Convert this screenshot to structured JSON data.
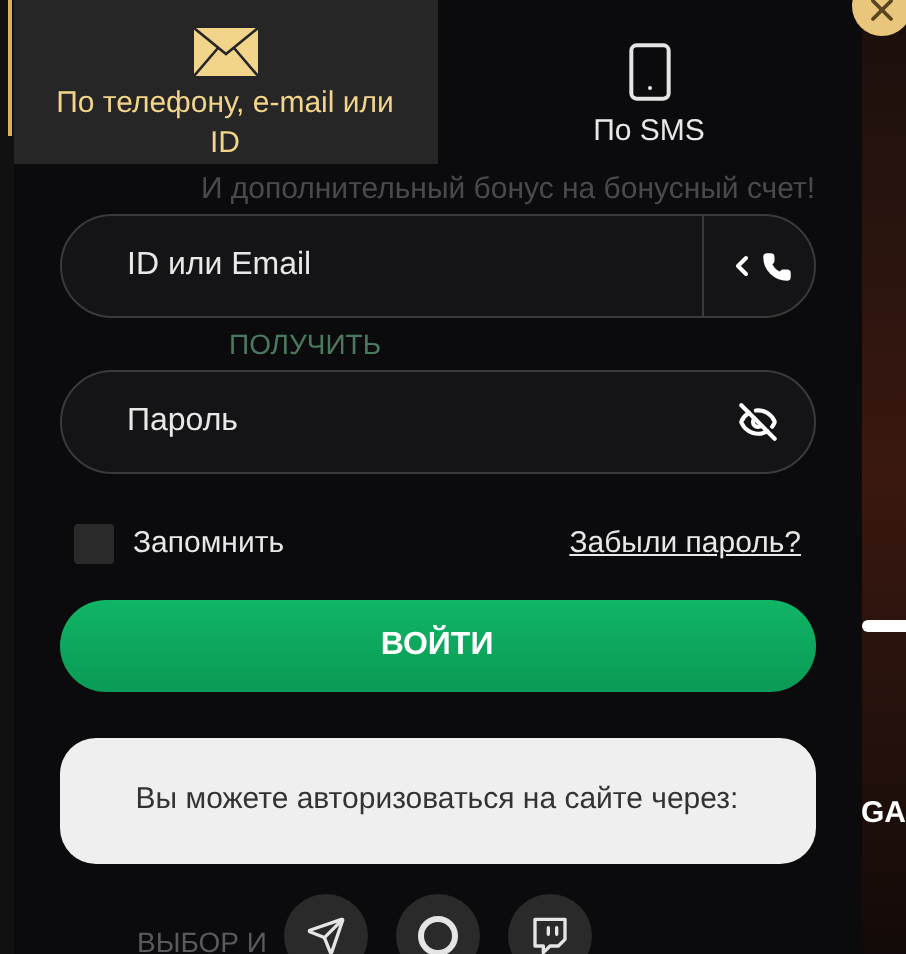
{
  "background": {
    "subtitle": "И дополнительный бонус на бонусный счет!",
    "button": "ПОЛУЧИТЬ",
    "section": "ВЫБОР И",
    "side_text": "GA"
  },
  "tabs": [
    {
      "label": "По телефону, e-mail или ID",
      "selected": true
    },
    {
      "label": "По SMS",
      "selected": false
    }
  ],
  "fields": [
    {
      "placeholder": "ID или Email",
      "kind": "login"
    },
    {
      "placeholder": "Пароль",
      "kind": "password"
    }
  ],
  "remember": {
    "label": "Запомнить",
    "checked": false
  },
  "forgot_link": "Забыли пароль?",
  "submit": "ВОЙТИ",
  "social_note": "Вы можете авторизоваться на сайте через:",
  "social": [
    {
      "kind": "telegram"
    },
    {
      "kind": "google"
    },
    {
      "kind": "twitch"
    }
  ]
}
